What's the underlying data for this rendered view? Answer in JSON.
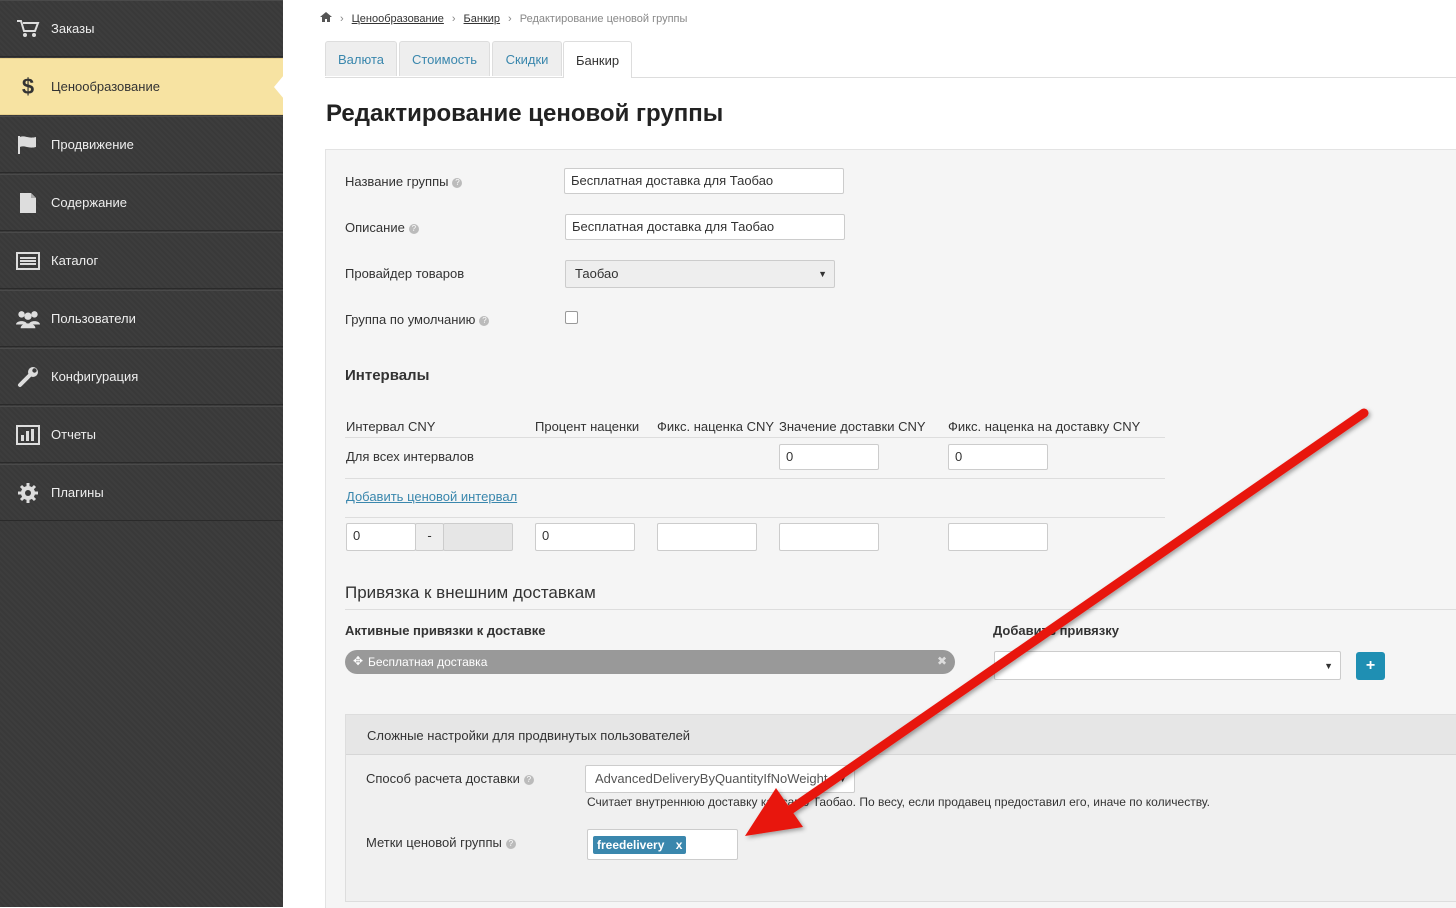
{
  "sidebar": {
    "items": [
      {
        "label": "Заказы",
        "icon": "cart-icon",
        "active": false
      },
      {
        "label": "Ценообразование",
        "icon": "dollar-icon",
        "active": true
      },
      {
        "label": "Продвижение",
        "icon": "flag-icon",
        "active": false
      },
      {
        "label": "Содержание",
        "icon": "document-icon",
        "active": false
      },
      {
        "label": "Каталог",
        "icon": "list-icon",
        "active": false
      },
      {
        "label": "Пользователи",
        "icon": "users-icon",
        "active": false
      },
      {
        "label": "Конфигурация",
        "icon": "wrench-icon",
        "active": false
      },
      {
        "label": "Отчеты",
        "icon": "chart-icon",
        "active": false
      },
      {
        "label": "Плагины",
        "icon": "gear-icon",
        "active": false
      }
    ]
  },
  "breadcrumb": {
    "home_icon": "home-icon",
    "items": [
      "Ценообразование",
      "Банкир",
      "Редактирование ценовой группы"
    ]
  },
  "tabs": [
    {
      "label": "Валюта",
      "active": false
    },
    {
      "label": "Стоимость",
      "active": false
    },
    {
      "label": "Скидки",
      "active": false
    },
    {
      "label": "Банкир",
      "active": true
    }
  ],
  "page_title": "Редактирование ценовой группы",
  "form": {
    "group_name_label": "Название группы",
    "group_name_value": "Бесплатная доставка для Таобао",
    "description_label": "Описание",
    "description_value": "Бесплатная доставка для Таобао",
    "provider_label": "Провайдер товаров",
    "provider_value": "Таобао",
    "default_group_label": "Группа по умолчанию",
    "default_group_checked": false
  },
  "intervals": {
    "title": "Интервалы",
    "headers": [
      "Интервал CNY",
      "Процент наценки",
      "Фикс. наценка CNY",
      "Значение доставки CNY",
      "Фикс. наценка на доставку CNY"
    ],
    "all_intervals_label": "Для всех интервалов",
    "all_delivery_value": "0",
    "all_fixed_delivery_value": "0",
    "add_link": "Добавить ценовой интервал",
    "row": {
      "from": "0",
      "dash": "-",
      "to": "",
      "percent": "0",
      "fixed": "",
      "delivery": "",
      "fixed_delivery": ""
    }
  },
  "external": {
    "title": "Привязка к внешним доставкам",
    "active_label": "Активные привязки к доставке",
    "active_item": "Бесплатная доставка",
    "add_label": "Добавить привязку",
    "add_select_value": "",
    "plus_label": "+"
  },
  "advanced": {
    "title": "Сложные настройки для продвинутых пользователей",
    "method_label": "Способ расчета доставки",
    "method_value": "AdvancedDeliveryByQuantityIfNoWeight",
    "method_hint": "Считает внутреннюю доставку как само Таобао. По весу, если продавец предоставил его, иначе по количеству.",
    "tags_label": "Метки ценовой группы",
    "tag": "freedelivery",
    "tag_remove": "x"
  },
  "colors": {
    "active_nav": "#f7e3a2",
    "link": "#3a87ad",
    "arrow": "#e8150e"
  }
}
